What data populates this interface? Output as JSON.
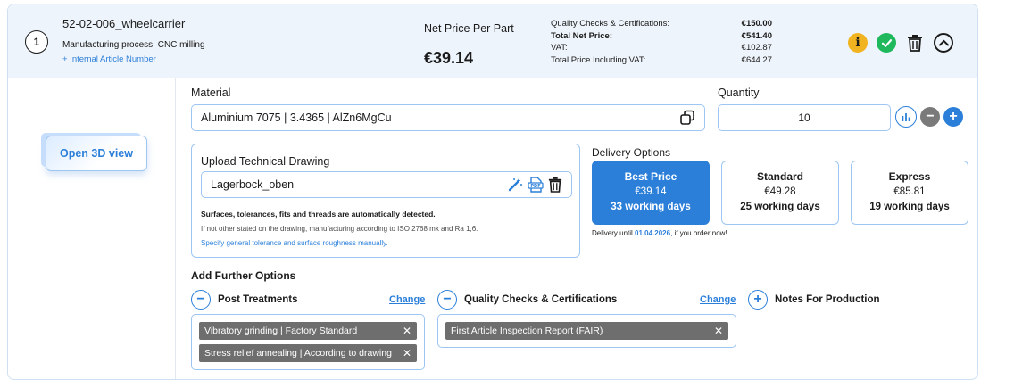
{
  "header": {
    "position": "1",
    "article_name": "52-02-006_wheelcarrier",
    "manufacturing_process": "Manufacturing process: CNC milling",
    "internal_article_link": "+ Internal Article Number",
    "net_price_label": "Net Price Per Part",
    "net_price_value": "€39.14",
    "totals": [
      {
        "label": "Quality Checks & Certifications:",
        "value": "€150.00",
        "bold": false
      },
      {
        "label": "Total Net Price:",
        "value": "€541.40",
        "bold": true
      },
      {
        "label": "VAT:",
        "value": "€102.87",
        "bold": false
      },
      {
        "label": "Total Price Including VAT:",
        "value": "€644.27",
        "bold": false
      }
    ],
    "icons": [
      "info-icon",
      "check-icon",
      "trash-icon",
      "chevron-up-icon"
    ],
    "colors": {
      "info": "#f2b321",
      "check": "#1fb85c",
      "accent": "#2b7fd9"
    }
  },
  "left": {
    "open_3d_label": "Open 3D view"
  },
  "material": {
    "label": "Material",
    "value": "Aluminium 7075 | 3.4365 | AlZn6MgCu"
  },
  "quantity": {
    "label": "Quantity",
    "value": "10"
  },
  "upload": {
    "title": "Upload Technical Drawing",
    "file_name": "Lagerbock_oben",
    "note_bold": "Surfaces, tolerances, fits and threads are automatically detected.",
    "note": "If not other stated on the drawing, manufacturing according to ISO 2768 mk and Ra 1,6.",
    "link": "Specify general tolerance and surface roughness manually."
  },
  "delivery": {
    "title": "Delivery Options",
    "options": [
      {
        "name": "Best Price",
        "price": "€39.14",
        "days": "33 working days",
        "selected": true
      },
      {
        "name": "Standard",
        "price": "€49.28",
        "days": "25 working days",
        "selected": false
      },
      {
        "name": "Express",
        "price": "€85.81",
        "days": "19 working days",
        "selected": false
      }
    ],
    "note_prefix": "Delivery until ",
    "note_date": "01.04.2026",
    "note_suffix": ", if you order now!"
  },
  "further": {
    "title": "Add Further Options",
    "post_treatments": {
      "label": "Post Treatments",
      "change": "Change",
      "tags": [
        "Vibratory grinding | Factory Standard",
        "Stress relief annealing | According to drawing"
      ]
    },
    "quality": {
      "label": "Quality Checks & Certifications",
      "change": "Change",
      "tags": [
        "First Article Inspection Report (FAIR)"
      ]
    },
    "notes": {
      "label": "Notes For Production"
    }
  }
}
